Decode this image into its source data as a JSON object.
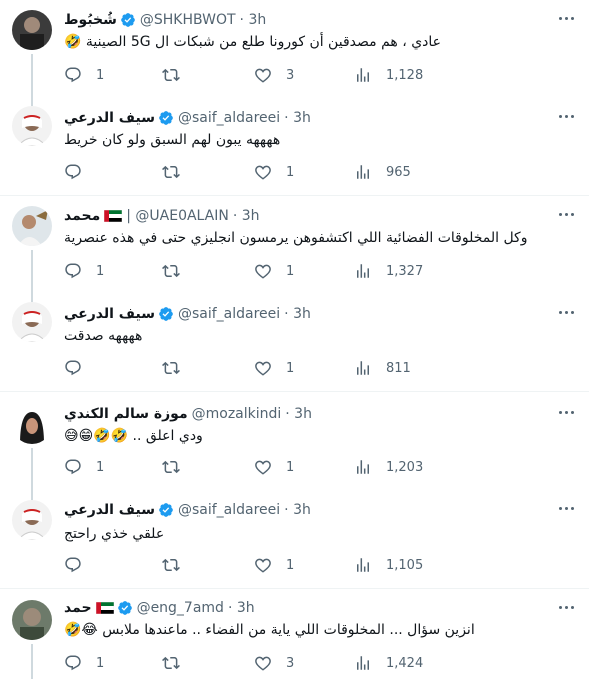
{
  "accent": "#1d9bf0",
  "tweets": [
    {
      "name": "شُخبُوط",
      "handle": "@SHKHBWOT",
      "time": "· 3h",
      "verified": true,
      "flag": false,
      "text": "عادي ، هم مصدقين أن كورونا طلع من شبكات ال 5G الصينية 🤣",
      "replies": "1",
      "retweets": "",
      "likes": "3",
      "views": "1,128"
    },
    {
      "name": "سيف الدرعي",
      "handle": "@saif_aldareei",
      "time": "· 3h",
      "verified": true,
      "flag": false,
      "text": "ههههه يبون لهم السبق ولو كان خريط",
      "replies": "",
      "retweets": "",
      "likes": "1",
      "views": "965"
    },
    {
      "name": "محمد",
      "handle": "| @UAE0ALAIN",
      "time": "· 3h",
      "verified": false,
      "flag": true,
      "text": "وكل المخلوقات الفضائية اللي اكتشفوهن يرمسون انجليزي حتى في هذه عنصرية",
      "replies": "1",
      "retweets": "",
      "likes": "1",
      "views": "1,327"
    },
    {
      "name": "سيف الدرعي",
      "handle": "@saif_aldareei",
      "time": "· 3h",
      "verified": true,
      "flag": false,
      "text": "ههههه صدقت",
      "replies": "",
      "retweets": "",
      "likes": "1",
      "views": "811"
    },
    {
      "name": "موزة سالم الكندي",
      "handle": "@mozalkindi",
      "time": "· 3h",
      "verified": false,
      "flag": false,
      "text": "ودي اعلق .. 🤣🤣😁😅",
      "replies": "1",
      "retweets": "",
      "likes": "1",
      "views": "1,203"
    },
    {
      "name": "سيف الدرعي",
      "handle": "@saif_aldareei",
      "time": "· 3h",
      "verified": true,
      "flag": false,
      "text": "علقي خذي راحتج",
      "replies": "",
      "retweets": "",
      "likes": "1",
      "views": "1,105"
    },
    {
      "name": "حمد",
      "handle": "@eng_7amd",
      "time": "· 3h",
      "verified": true,
      "flag": true,
      "text": "انزين سؤال ... المخلوقات اللي ياية من الفضاء .. ماعندها ملابس 😂🤣",
      "replies": "1",
      "retweets": "",
      "likes": "3",
      "views": "1,424"
    }
  ]
}
